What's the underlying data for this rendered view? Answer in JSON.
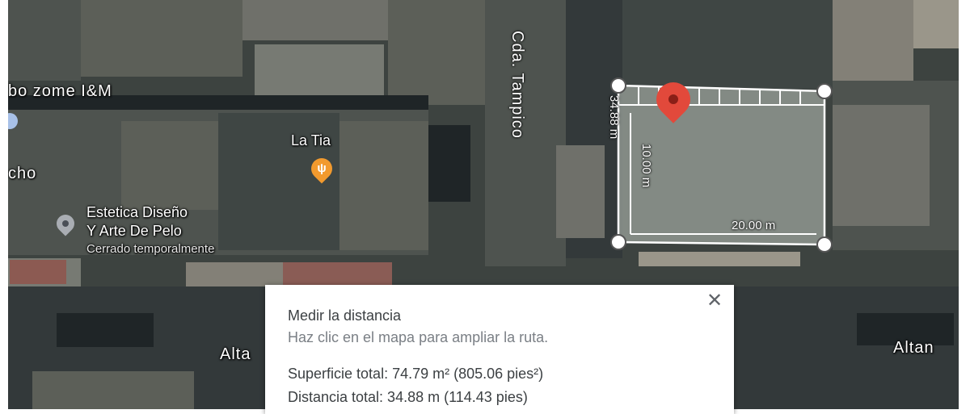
{
  "map": {
    "street_label": "Cda. Tampico",
    "places": [
      {
        "name": "bo zome I&M"
      },
      {
        "name": "La Tia",
        "icon": "fork-knife-icon"
      },
      {
        "name": "cho"
      },
      {
        "name": "Estetica Diseño",
        "name_line2": "Y Arte De Pelo",
        "status": "Cerrado temporalmente"
      }
    ],
    "road_label_left": "Alta",
    "road_label_right": "Altan"
  },
  "measurement": {
    "side_top": "34.88 m",
    "side_left": "10.00 m",
    "side_bottom": "20.00 m",
    "line_color": "#ffffff",
    "pin_color": "#e2493b",
    "fill_color": "#8f9791"
  },
  "panel": {
    "title": "Medir la distancia",
    "hint": "Haz clic en el mapa para ampliar la ruta.",
    "area_text": "Superficie total: 74.79 m² (805.06 pies²)",
    "distance_text": "Distancia total: 34.88 m (114.43 pies)",
    "close_icon": "close-icon"
  }
}
